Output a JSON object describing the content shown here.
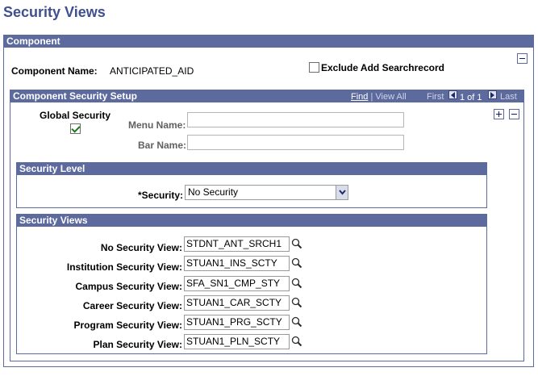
{
  "page_title": "Security Views",
  "component": {
    "header": "Component",
    "name_label": "Component Name:",
    "name_value": "ANTICIPATED_AID",
    "exclude_label": "Exclude Add Searchrecord",
    "exclude_checked": false
  },
  "setup": {
    "header": "Component Security Setup",
    "nav": {
      "find": "Find",
      "separator": "|",
      "view_all": "View All",
      "first": "First",
      "count": "1 of 1",
      "last": "Last"
    },
    "global_security_label": "Global Security",
    "global_security_checked": true,
    "menu_name_label": "Menu Name:",
    "menu_name_value": "",
    "bar_name_label": "Bar Name:",
    "bar_name_value": ""
  },
  "security_level": {
    "header": "Security Level",
    "security_label": "*Security:",
    "security_value": "No Security"
  },
  "security_views": {
    "header": "Security Views",
    "rows": [
      {
        "label": "No Security View:",
        "value": "STDNT_ANT_SRCH1"
      },
      {
        "label": "Institution Security View:",
        "value": "STUAN1_INS_SCTY"
      },
      {
        "label": "Campus Security View:",
        "value": "SFA_SN1_CMP_STY"
      },
      {
        "label": "Career Security View:",
        "value": "STUAN1_CAR_SCTY"
      },
      {
        "label": "Program Security View:",
        "value": "STUAN1_PRG_SCTY"
      },
      {
        "label": "Plan Security View:",
        "value": "STUAN1_PLN_SCTY"
      }
    ]
  },
  "icons": {
    "collapse": "minus-icon",
    "add_row": "plus-icon",
    "delete_row": "minus-icon",
    "prompt": "magnifier-icon",
    "prev": "left-arrow-icon",
    "next": "right-arrow-icon"
  },
  "colors": {
    "title": "#3f4f8f",
    "header_bg": "#5c6a9d",
    "header_text": "#ffffff",
    "check": "#1d7a1d"
  }
}
